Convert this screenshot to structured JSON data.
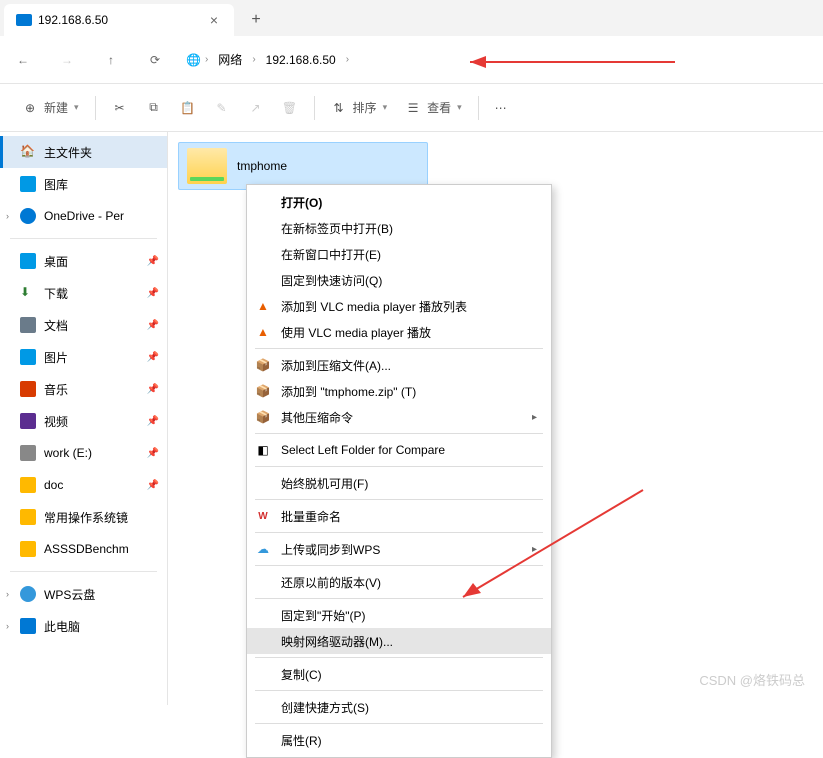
{
  "tab": {
    "title": "192.168.6.50"
  },
  "breadcrumb": {
    "seg1": "网络",
    "seg2": "192.168.6.50"
  },
  "toolbar": {
    "new": "新建",
    "sort": "排序",
    "view": "查看"
  },
  "sidebar": {
    "home": "主文件夹",
    "gallery": "图库",
    "onedrive": "OneDrive - Per",
    "desktop": "桌面",
    "downloads": "下载",
    "documents": "文档",
    "pictures": "图片",
    "music": "音乐",
    "videos": "视频",
    "drive_e": "work (E:)",
    "doc": "doc",
    "folder_long": "常用操作系统镜",
    "asssd": "ASSSDBenchm",
    "wps": "WPS云盘",
    "thispc": "此电脑"
  },
  "content": {
    "folder_name": "tmphome"
  },
  "context_menu": {
    "open": "打开(O)",
    "open_new_tab": "在新标签页中打开(B)",
    "open_new_window": "在新窗口中打开(E)",
    "pin_quick": "固定到快速访问(Q)",
    "vlc_add": "添加到 VLC media player 播放列表",
    "vlc_play": "使用 VLC media player 播放",
    "compress_a": "添加到压缩文件(A)...",
    "compress_zip": "添加到 \"tmphome.zip\" (T)",
    "compress_other": "其他压缩命令",
    "compare": "Select Left Folder for Compare",
    "offline": "始终脱机可用(F)",
    "batch_rename": "批量重命名",
    "upload_wps": "上传或同步到WPS",
    "restore": "还原以前的版本(V)",
    "pin_start": "固定到\"开始\"(P)",
    "map_drive": "映射网络驱动器(M)...",
    "copy": "复制(C)",
    "shortcut": "创建快捷方式(S)",
    "properties": "属性(R)"
  },
  "watermark": "CSDN @烙铁码总"
}
